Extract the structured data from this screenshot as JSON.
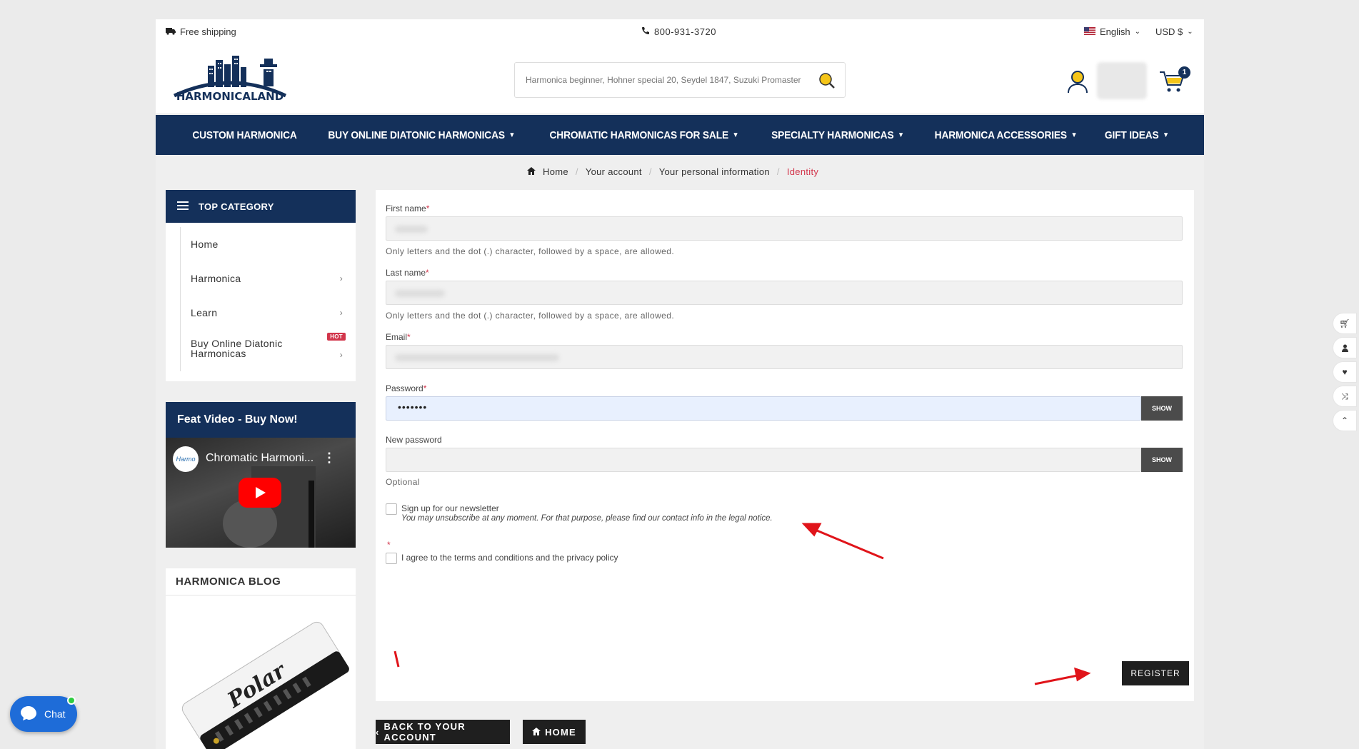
{
  "topbar": {
    "shipping": "Free shipping",
    "phone": "800-931-3720",
    "language": "English",
    "currency": "USD $"
  },
  "logo": {
    "text": "HARMONICALAND"
  },
  "search": {
    "placeholder": "Harmonica beginner, Hohner special 20, Seydel 1847, Suzuki Promaster"
  },
  "cart": {
    "count": "1"
  },
  "nav": {
    "items": [
      "CUSTOM HARMONICA",
      "BUY ONLINE DIATONIC HARMONICAS",
      "CHROMATIC HARMONICAS FOR SALE",
      "SPECIALTY HARMONICAS",
      "HARMONICA ACCESSORIES",
      "GIFT IDEAS"
    ]
  },
  "breadcrumb": {
    "home": "Home",
    "account": "Your account",
    "personal": "Your personal information",
    "current": "Identity"
  },
  "sidebar": {
    "top_category": "TOP CATEGORY",
    "items": [
      "Home",
      "Harmonica",
      "Learn",
      "Buy Online Diatonic Harmonicas"
    ],
    "hot_badge": "HOT",
    "video_title": "Feat Video - Buy Now!",
    "video_caption": "Chromatic Harmoni...",
    "channel_logo": "Harmo",
    "blog_title": "HARMONICA BLOG",
    "blog_image_text": "Polar"
  },
  "form": {
    "first_name_label": "First name",
    "last_name_label": "Last name",
    "email_label": "Email",
    "password_label": "Password",
    "new_password_label": "New password",
    "required_mark": "*",
    "name_help": "Only letters and the dot (.) character, followed by a space, are allowed.",
    "password_value": "•••••••",
    "show_label": "SHOW",
    "optional": "Optional",
    "newsletter_label": "Sign up for our newsletter",
    "newsletter_note": "You may unsubscribe at any moment. For that purpose, please find our contact info in the legal notice.",
    "terms_label": "I agree to the terms and conditions and the privacy policy",
    "register_label": "REGISTER"
  },
  "footer_buttons": {
    "back": "BACK TO YOUR ACCOUNT",
    "home": "HOME"
  },
  "chat": {
    "label": "Chat"
  },
  "colors": {
    "navy": "#14305a",
    "accent_red": "#d2354b",
    "annotation_red": "#e0141a"
  }
}
